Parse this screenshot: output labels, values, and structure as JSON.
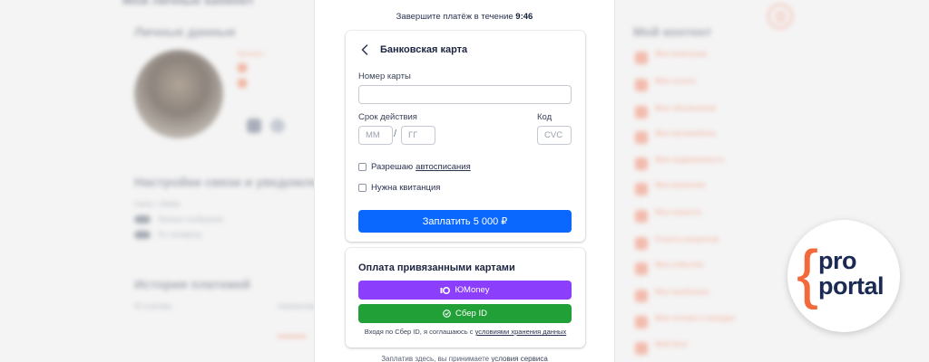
{
  "background": {
    "page_title": "Мои личные кабинет",
    "personal_heading": "Личные данные",
    "user_name": "Михаил",
    "settings_heading": "Настройки связи и уведомлений",
    "contact_label": "Связь с Вами",
    "toggle_1": "Личные сообщения",
    "toggle_2": "По телефону",
    "history_heading": "История платежей",
    "history_col_1": "ID платежа",
    "history_col_2": "Наименование",
    "content_heading": "Мой контент",
    "menu": [
      "Мои компании",
      "Мои услуги",
      "Мои объявления",
      "Мои автомобили",
      "Мои недвижимость",
      "Мои вакансии",
      "Мои новости",
      "Ответы вопросов",
      "Мои события",
      "Мои проблемы",
      "Мои потери и находки",
      "Мой блог"
    ]
  },
  "timer": {
    "prefix": "Завершите платёж в течение",
    "time": "9:46"
  },
  "bank_card": {
    "title": "Банковская карта",
    "card_number_label": "Номер карты",
    "card_number_value": "",
    "expiry_label": "Срок действия",
    "month_placeholder": "ММ",
    "year_placeholder": "ГГ",
    "separator": "/",
    "code_label": "Код",
    "cvc_placeholder": "CVC",
    "autopay_text": "Разрешаю",
    "autopay_link": "автосписания",
    "receipt_text": "Нужна квитанция",
    "pay_button": "Заплатить  5 000 ₽"
  },
  "linked": {
    "title": "Оплата привязанными картами",
    "yoomoney": "ЮMoney",
    "sber": "Сбер ID",
    "note_prefix": "Входя по Сбер ID, я соглашаюсь с",
    "note_link": "условиями хранения данных"
  },
  "footer": {
    "prefix": "Заплатив здесь, вы принимаете",
    "link": "условия сервиса"
  },
  "logo": {
    "brace": "{",
    "line1": "pro",
    "line2": "portal"
  },
  "colors": {
    "pay_blue": "#0a68ff",
    "yoomoney_purple": "#8b3ffd",
    "sber_green": "#21a038",
    "brand_orange": "#f26a3b",
    "brand_navy": "#1a2a52"
  }
}
